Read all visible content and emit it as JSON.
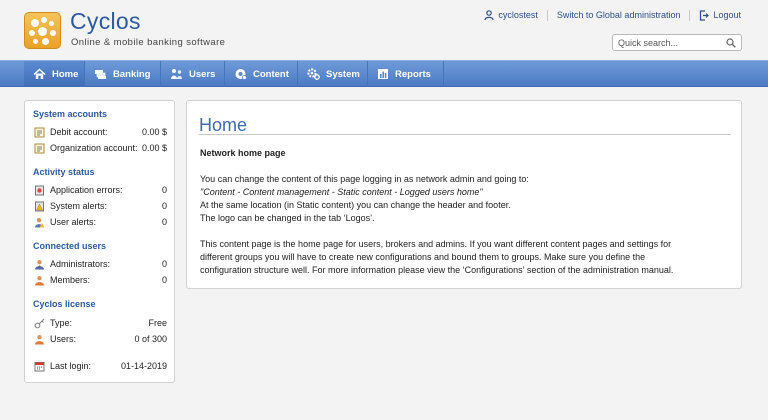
{
  "brand": {
    "name": "Cyclos",
    "tagline": "Online & mobile banking software"
  },
  "toplinks": {
    "user": "cyclostest",
    "switch": "Switch to Global administration",
    "logout": "Logout"
  },
  "search": {
    "placeholder": "Quick search..."
  },
  "nav": [
    {
      "label": "Home",
      "icon": "home-icon",
      "active": true
    },
    {
      "label": "Banking",
      "icon": "banking-icon",
      "active": false
    },
    {
      "label": "Users",
      "icon": "users-icon",
      "active": false
    },
    {
      "label": "Content",
      "icon": "content-icon",
      "active": false
    },
    {
      "label": "System",
      "icon": "system-icon",
      "active": false
    },
    {
      "label": "Reports",
      "icon": "reports-icon",
      "active": false
    }
  ],
  "sidebar": {
    "system_accounts": {
      "title": "System accounts",
      "rows": [
        {
          "label": "Debit account:",
          "value": "0.00 $",
          "icon": "account-icon"
        },
        {
          "label": "Organization account:",
          "value": "0.00 $",
          "icon": "account-icon"
        }
      ]
    },
    "activity_status": {
      "title": "Activity status",
      "rows": [
        {
          "label": "Application errors:",
          "value": "0",
          "icon": "error-icon"
        },
        {
          "label": "System alerts:",
          "value": "0",
          "icon": "warning-icon"
        },
        {
          "label": "User alerts:",
          "value": "0",
          "icon": "user-alert-icon"
        }
      ]
    },
    "connected_users": {
      "title": "Connected users",
      "rows": [
        {
          "label": "Administrators:",
          "value": "0",
          "icon": "admin-icon"
        },
        {
          "label": "Members:",
          "value": "0",
          "icon": "member-icon"
        }
      ]
    },
    "license": {
      "title": "Cyclos license",
      "rows": [
        {
          "label": "Type:",
          "value": "Free",
          "icon": "key-icon"
        },
        {
          "label": "Users:",
          "value": "0 of 300",
          "icon": "user-icon"
        }
      ]
    },
    "last_login": {
      "label": "Last login:",
      "value": "01-14-2019",
      "icon": "calendar-icon"
    }
  },
  "content": {
    "title": "Home",
    "subheading": "Network home page",
    "para1": [
      "You can change the content of this page logging in as network admin and going to:",
      "\"Content - Content management - Static content - Logged users home\"",
      "At the same location (in Static content) you can change the header and footer.",
      "The logo can be changed in the tab ‘Logos’."
    ],
    "para2": [
      "This content page is the home page for users, brokers and admins. If you want different content pages and settings for",
      "different groups you will have to create new configurations and bound them to groups. Make sure you define the",
      "configuration structure well. For more information please view the ‘Configurations’ section of the administration manual."
    ]
  },
  "colors": {
    "accent": "#2c5aa0",
    "nav": "#5a88cf",
    "logo": "#f0b030"
  }
}
